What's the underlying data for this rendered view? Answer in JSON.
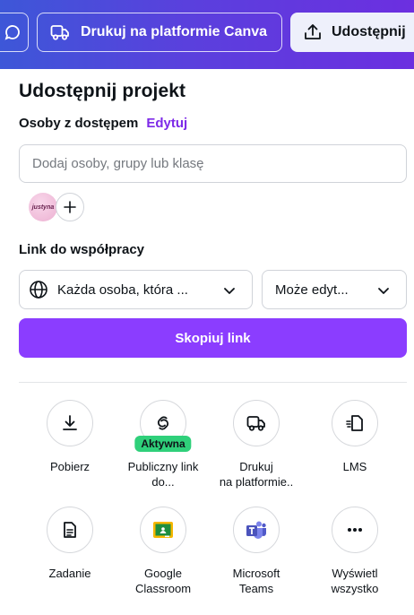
{
  "topbar": {
    "print_label": "Drukuj na platformie Canva",
    "share_label": "Udostępnij"
  },
  "panel": {
    "title": "Udostępnij projekt",
    "access_label": "Osoby z dostępem",
    "edit_link": "Edytuj",
    "people_placeholder": "Dodaj osoby, grupy lub klasę",
    "avatar_text": "justyna",
    "link_heading": "Link do współpracy",
    "who_select_value": "Każda osoba, która ...",
    "permission_select_value": "Może edyt...",
    "copy_button": "Skopiuj link"
  },
  "share_options": [
    {
      "id": "download",
      "icon": "download-icon",
      "lines": [
        "Pobierz"
      ]
    },
    {
      "id": "public-link",
      "icon": "link-icon",
      "lines": [
        "Publiczny link",
        "do..."
      ],
      "badge": "Aktywna"
    },
    {
      "id": "print",
      "icon": "truck-icon",
      "lines": [
        "Drukuj",
        "na platformie.."
      ]
    },
    {
      "id": "lms",
      "icon": "lms-icon",
      "lines": [
        "LMS"
      ]
    },
    {
      "id": "assignment",
      "icon": "assignment-icon",
      "lines": [
        "Zadanie"
      ]
    },
    {
      "id": "google-classroom",
      "icon": "google-classroom-icon",
      "lines": [
        "Google",
        "Classroom"
      ]
    },
    {
      "id": "microsoft-teams",
      "icon": "microsoft-teams-icon",
      "lines": [
        "Microsoft",
        "Teams"
      ]
    },
    {
      "id": "show-all",
      "icon": "more-icon",
      "lines": [
        "Wyświetl",
        "wszystko"
      ]
    }
  ],
  "colors": {
    "accent": "#8b3dff",
    "edit_link": "#7d2ae8",
    "badge": "#2fd07a",
    "topbar_start": "#3d57d8",
    "topbar_end": "#6c2fe0"
  }
}
